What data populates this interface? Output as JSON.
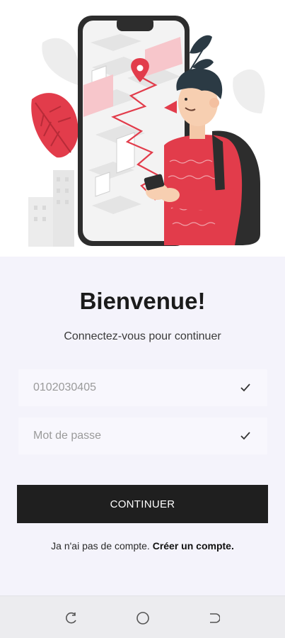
{
  "hero": {
    "illustration": "person-with-phone-map-illustration",
    "accent_color": "#e23c4b"
  },
  "login": {
    "title": "Bienvenue!",
    "subtitle": "Connectez-vous pour continuer",
    "phone_field": {
      "value": "0102030405",
      "placeholder": ""
    },
    "password_field": {
      "value": "",
      "placeholder": "Mot de passe"
    },
    "check_icon": "check-icon",
    "submit_label": "CONTINUER",
    "signup_prompt": "Ja n'ai pas de compte.",
    "signup_link": "Créer un compte.",
    "button_color": "#1f1f1f",
    "background_color": "#f4f3fb"
  },
  "navbar": {
    "recent_icon": "recent-apps-icon",
    "home_icon": "home-icon",
    "back_icon": "back-icon"
  }
}
